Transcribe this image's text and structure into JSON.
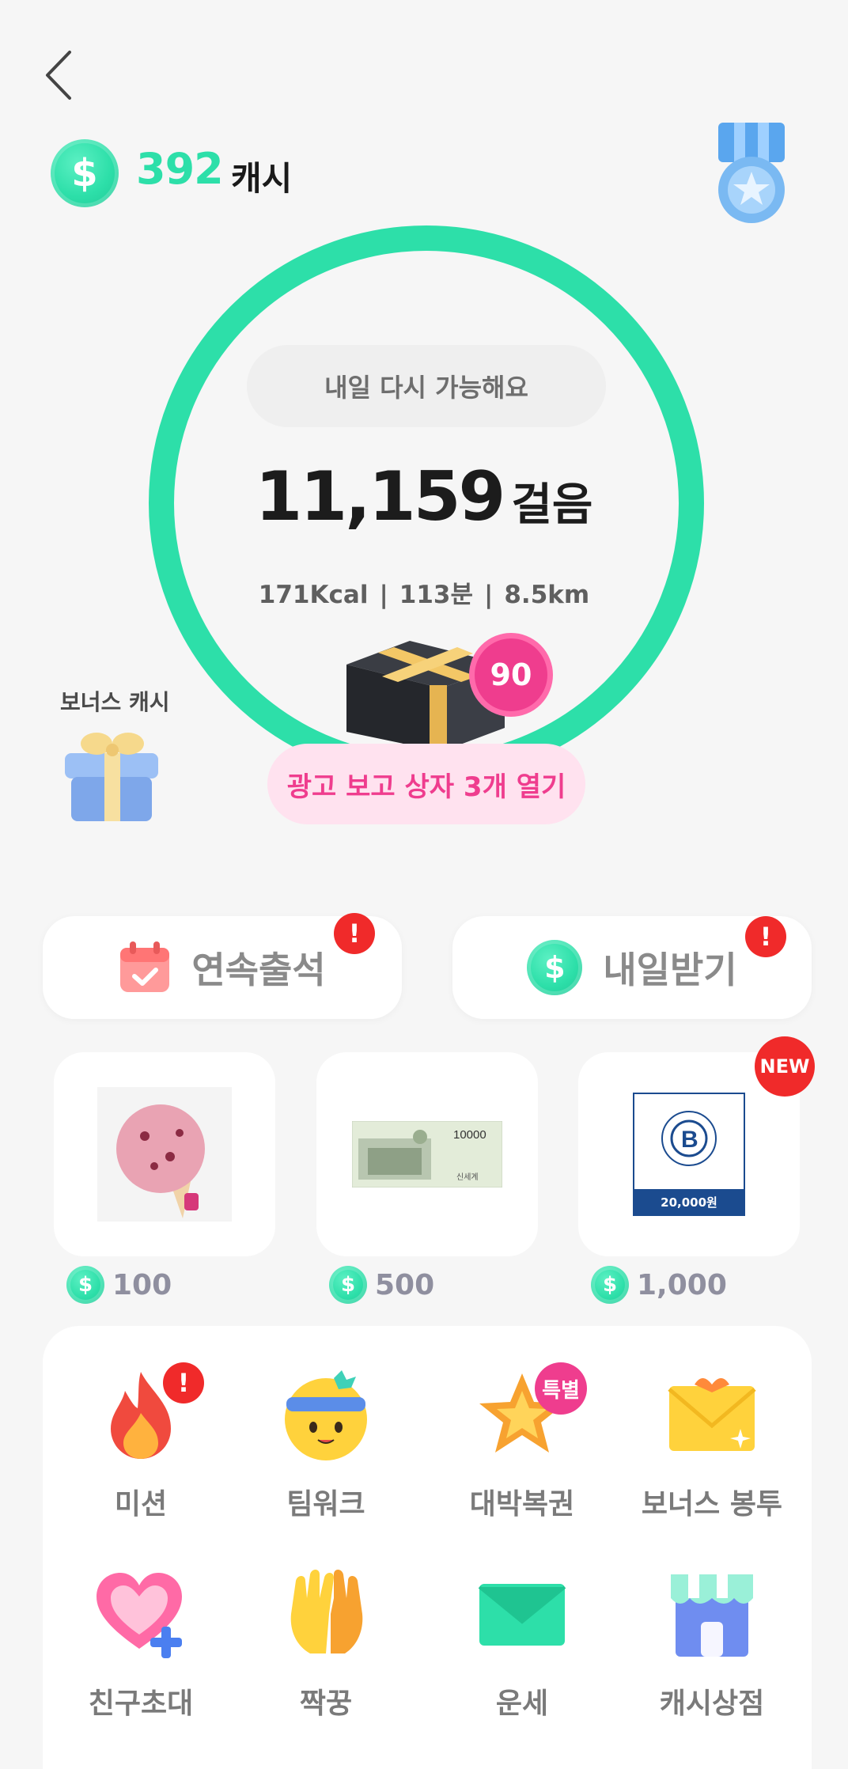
{
  "header": {
    "cash_amount": "392",
    "cash_unit": "캐시",
    "coin_symbol": "$"
  },
  "ring": {
    "status_text": "내일 다시 가능해요",
    "steps": "11,159",
    "steps_unit": "걸음",
    "kcal": "171Kcal",
    "minutes": "113분",
    "distance": "8.5km",
    "separator": "|",
    "accent_color": "#2ddfa9"
  },
  "reward_box": {
    "badge_count": "90",
    "ad_button_label": "광고 보고 상자 3개 열기"
  },
  "bonus": {
    "label": "보너스 캐시"
  },
  "actions": {
    "attendance_label": "연속출석",
    "tomorrow_label": "내일받기",
    "alert_symbol": "!"
  },
  "products": [
    {
      "name": "아이스크림",
      "price": "100"
    },
    {
      "name": "상품권",
      "price": "500",
      "voucher_text": "10000",
      "brand": "신세계"
    },
    {
      "name": "파리바게뜨",
      "price": "1,000",
      "voucher_value": "20,000원",
      "badge": "NEW"
    }
  ],
  "menu": [
    {
      "label": "미션",
      "icon": "fire-icon",
      "badge": "!"
    },
    {
      "label": "팀워크",
      "icon": "smiley-headband-icon"
    },
    {
      "label": "대박복권",
      "icon": "star-icon",
      "badge": "특별"
    },
    {
      "label": "보너스 봉투",
      "icon": "envelope-gift-icon"
    },
    {
      "label": "친구초대",
      "icon": "heart-plus-icon"
    },
    {
      "label": "짝꿍",
      "icon": "clapping-hands-icon"
    },
    {
      "label": "운세",
      "icon": "mail-icon"
    },
    {
      "label": "캐시상점",
      "icon": "store-icon"
    }
  ]
}
